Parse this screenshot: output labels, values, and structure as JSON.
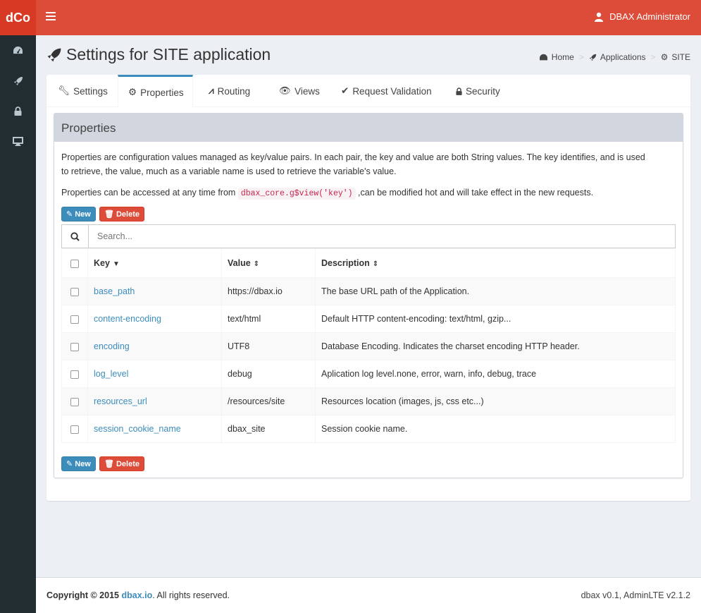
{
  "app": {
    "logo": "dCo"
  },
  "topbar": {
    "user_name": "DBAX Administrator"
  },
  "sidebar": {
    "items": [
      {
        "icon": "dashboard-icon"
      },
      {
        "icon": "rocket-icon"
      },
      {
        "icon": "lock-icon"
      },
      {
        "icon": "desktop-icon"
      }
    ]
  },
  "header": {
    "title": "Settings for SITE application",
    "breadcrumb": [
      "Home",
      "Applications",
      "SITE"
    ]
  },
  "tabs": [
    {
      "label": "Settings",
      "icon": "wrench-icon"
    },
    {
      "label": "Properties",
      "icon": "gear-icon",
      "active": true
    },
    {
      "label": "Routing",
      "icon": "road-icon"
    },
    {
      "label": "Views",
      "icon": "eye-icon"
    },
    {
      "label": "Request Validation",
      "icon": "check-icon"
    },
    {
      "label": "Security",
      "icon": "lock-icon"
    }
  ],
  "panel": {
    "title": "Properties",
    "para1a": "Properties are configuration values managed as key/value pairs. In each pair, the key and value are both String values. The key identifies, and is used",
    "para1b": "to retrieve, the value, much as a variable name is used to retrieve the variable's value.",
    "para2_pre": "Properties can be accessed at any time from",
    "para2_code": "dbax_core.g$view('key')",
    "para2_post": ",can be modified hot and will take effect in the new requests.",
    "new_label": "New",
    "delete_label": "Delete",
    "search_placeholder": "Search..."
  },
  "table": {
    "columns": [
      "Key",
      "Value",
      "Description"
    ],
    "rows": [
      {
        "key": "base_path",
        "value": "https://dbax.io",
        "description": "The base URL path of the Application."
      },
      {
        "key": "content-encoding",
        "value": "text/html",
        "description": "Default HTTP content-encoding: text/html, gzip..."
      },
      {
        "key": "encoding",
        "value": "UTF8",
        "description": "Database Encoding. Indicates the charset encoding HTTP header."
      },
      {
        "key": "log_level",
        "value": "debug",
        "description": "Aplication log level.none, error, warn, info, debug, trace"
      },
      {
        "key": "resources_url",
        "value": "/resources/site",
        "description": "Resources location (images, js, css etc...)"
      },
      {
        "key": "session_cookie_name",
        "value": "dbax_site",
        "description": "Session cookie name."
      }
    ]
  },
  "footer": {
    "copyright_pre": "Copyright © 2015",
    "link": "dbax.io",
    "copyright_post": ". All rights reserved.",
    "version": "dbax v0.1, AdminLTE v2.1.2"
  },
  "colors": {
    "header": "#dd4b39",
    "logo": "#d73925",
    "sidebar": "#222d32",
    "primary": "#3c8dbc",
    "danger": "#dd4b39"
  }
}
